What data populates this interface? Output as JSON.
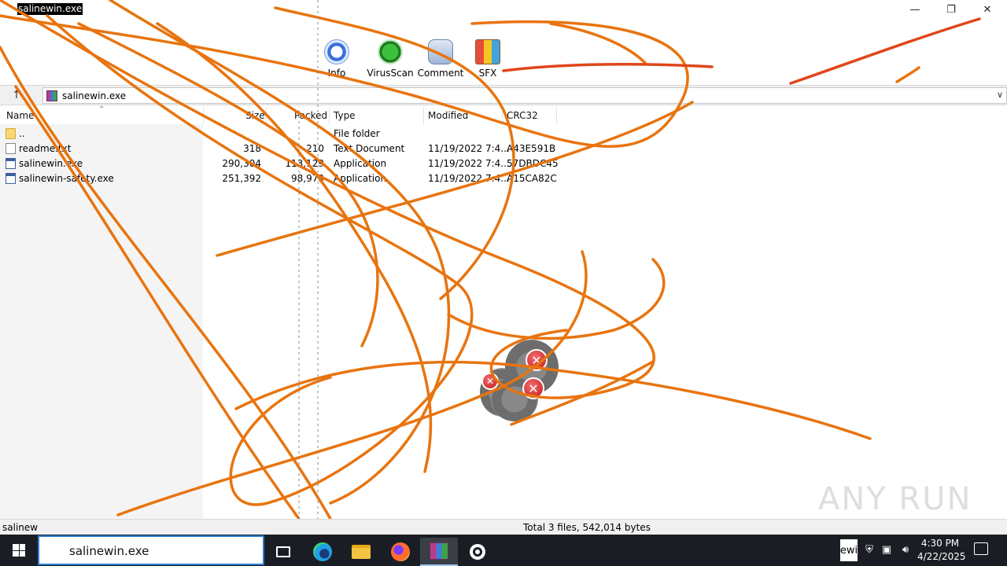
{
  "window": {
    "title": "salinewin.exe"
  },
  "toolbar": {
    "buttons": [
      {
        "label": "Info",
        "icon": "info-icon"
      },
      {
        "label": "VirusScan",
        "icon": "virusscan-icon"
      },
      {
        "label": "Comment",
        "icon": "comment-icon"
      },
      {
        "label": "SFX",
        "icon": "sfx-icon"
      }
    ]
  },
  "address": {
    "path": "salinewin.exe"
  },
  "columns": {
    "name": "Name",
    "size": "Size",
    "packed": "Packed",
    "type": "Type",
    "modified": "Modified",
    "crc": "CRC32"
  },
  "files": [
    {
      "name": "..",
      "size": "",
      "packed": "",
      "type": "File folder",
      "modified": "",
      "crc": "",
      "icon": "folder"
    },
    {
      "name": "readme.txt",
      "size": "318",
      "packed": "210",
      "type": "Text Document",
      "modified": "11/19/2022 7:4...",
      "crc": "A43E591B",
      "icon": "text"
    },
    {
      "name": "salinewin.exe",
      "size": "290,304",
      "packed": "113,129",
      "type": "Application",
      "modified": "11/19/2022 7:4...",
      "crc": "57DBDC45",
      "icon": "app"
    },
    {
      "name": "salinewin-safety.exe",
      "size": "251,392",
      "packed": "98,979",
      "type": "Application",
      "modified": "11/19/2022 7:4...",
      "crc": "A15CA82C",
      "icon": "app"
    }
  ],
  "status": {
    "left": "salinew",
    "right": "Total 3 files, 542,014 bytes"
  },
  "watermark": "ANY RUN",
  "taskbar": {
    "search_text": "salinewin.exe",
    "tray_thumb": "ewi",
    "time": "4:30 PM",
    "date": "4/22/2025"
  },
  "colors": {
    "scribble": "#e8740f",
    "scribble_dark": "#e0461a",
    "taskbar_bg": "#1a1e24",
    "accent": "#2b7cd3"
  }
}
